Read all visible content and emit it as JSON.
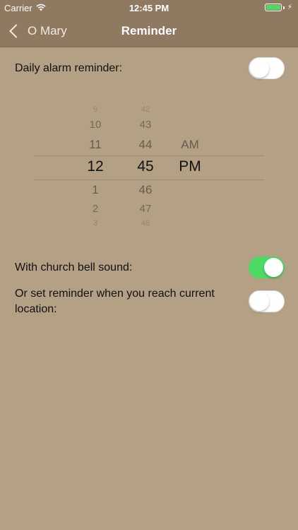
{
  "status": {
    "carrier": "Carrier",
    "time": "12:45 PM",
    "battery_color": "#4cd964"
  },
  "nav": {
    "back_label": "O Mary",
    "title": "Reminder"
  },
  "daily_alarm": {
    "label": "Daily alarm reminder:",
    "enabled": false
  },
  "time_picker": {
    "hours": [
      "9",
      "10",
      "11",
      "12",
      "1",
      "2",
      "3"
    ],
    "minutes": [
      "42",
      "43",
      "44",
      "45",
      "46",
      "47",
      "48"
    ],
    "periods": [
      "AM",
      "PM"
    ],
    "selected_hour": "12",
    "selected_minute": "45",
    "selected_period": "PM"
  },
  "church_bell": {
    "label": "With church bell sound:",
    "enabled": true
  },
  "location_reminder": {
    "label": "Or set reminder when you reach current location:",
    "enabled": false
  },
  "colors": {
    "background": "#b4a185",
    "bar": "#8f7960",
    "toggle_on": "#4cd964"
  }
}
